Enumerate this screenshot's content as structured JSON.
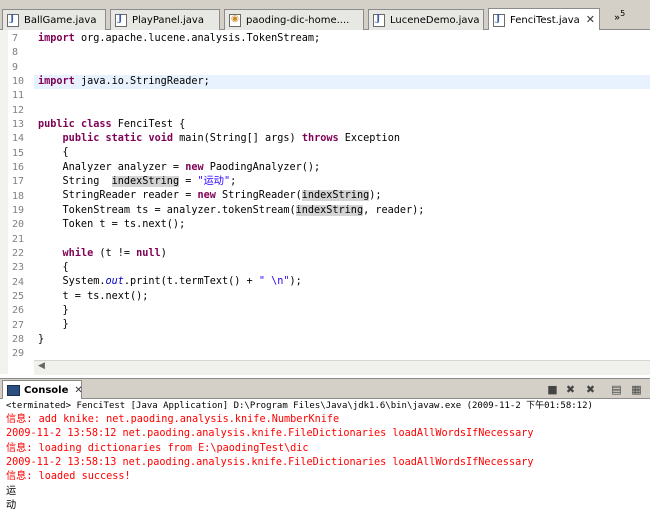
{
  "tabs": [
    {
      "label": "BallGame.java",
      "icon": "java-file-icon"
    },
    {
      "label": "PlayPanel.java",
      "icon": "java-file-icon"
    },
    {
      "label": "paoding-dic-home....",
      "icon": "html-file-icon"
    },
    {
      "label": "LuceneDemo.java",
      "icon": "java-file-icon"
    },
    {
      "label": "FenciTest.java",
      "icon": "java-file-icon",
      "active": true
    }
  ],
  "tab_close_glyph": "✕",
  "tab_overflow": {
    "glyph": "»",
    "count": "5"
  },
  "line_numbers": [
    "7",
    "8",
    "9",
    "10",
    "11",
    "12",
    "13",
    "14",
    "15",
    "16",
    "17",
    "18",
    "19",
    "20",
    "21",
    "22",
    "23",
    "24",
    "25",
    "26",
    "27",
    "28",
    "29"
  ],
  "code": {
    "l7": {
      "kw": "import",
      "rest": " org.apache.lucene.analysis.TokenStream;"
    },
    "l10": {
      "kw": "import",
      "rest": " java.io.StringReader;"
    },
    "l13": {
      "kw1": "public",
      "kw2": "class",
      "rest": " FenciTest {"
    },
    "l14": {
      "indent": "    ",
      "kw1": "public",
      "kw2": "static",
      "kw3": "void",
      "mid": " main(String[] args) ",
      "kw4": "throws",
      "rest": " Exception"
    },
    "l15": "    {",
    "l16": {
      "pre": "    Analyzer analyzer = ",
      "kw": "new",
      "rest": " PaodingAnalyzer();"
    },
    "l17": {
      "pre": "    String  ",
      "var": "indexString",
      "mid": " = ",
      "str": "\"运动\"",
      "end": ";"
    },
    "l18": {
      "pre": "    StringReader reader = ",
      "kw": "new",
      "mid": " StringReader(",
      "var": "indexString",
      "end": ");"
    },
    "l19": {
      "pre": "    TokenStream ts = analyzer.tokenStream(",
      "var": "indexString",
      "end": ", reader);"
    },
    "l20": "    Token t = ts.next();",
    "l22": {
      "indent": "    ",
      "kw": "while",
      "mid": " (t != ",
      "kw2": "null",
      "end": ")"
    },
    "l23": "    {",
    "l24": {
      "pre": "    System.",
      "fld": "out",
      "mid": ".print(t.termText() + ",
      "str": "\" \\n\"",
      "end": ");"
    },
    "l25": "    t = ts.next();",
    "l26": "    }",
    "l27": "    }",
    "l29": "}"
  },
  "console": {
    "tab_label": "Console",
    "tab_close": "✕",
    "status": "<terminated> FenciTest [Java Application] D:\\Program Files\\Java\\jdk1.6\\bin\\javaw.exe (2009-11-2 下午01:58:12)",
    "lines": [
      {
        "text": "信息: add knike: net.paoding.analysis.knife.NumberKnife",
        "type": "err"
      },
      {
        "text": "2009-11-2 13:58:12 net.paoding.analysis.knife.FileDictionaries loadAllWordsIfNecessary",
        "type": "err"
      },
      {
        "text": "信息: loading dictionaries from E:\\paodingTest\\dic",
        "type": "err"
      },
      {
        "text": "2009-11-2 13:58:13 net.paoding.analysis.knife.FileDictionaries loadAllWordsIfNecessary",
        "type": "err"
      },
      {
        "text": "信息: loaded success!",
        "type": "err"
      },
      {
        "text": "运",
        "type": "out"
      },
      {
        "text": "动",
        "type": "out"
      }
    ]
  },
  "colors": {
    "keyword": "#7f0055",
    "string": "#2a00ff",
    "stderr": "#ff0000",
    "field": "#0000c0"
  }
}
